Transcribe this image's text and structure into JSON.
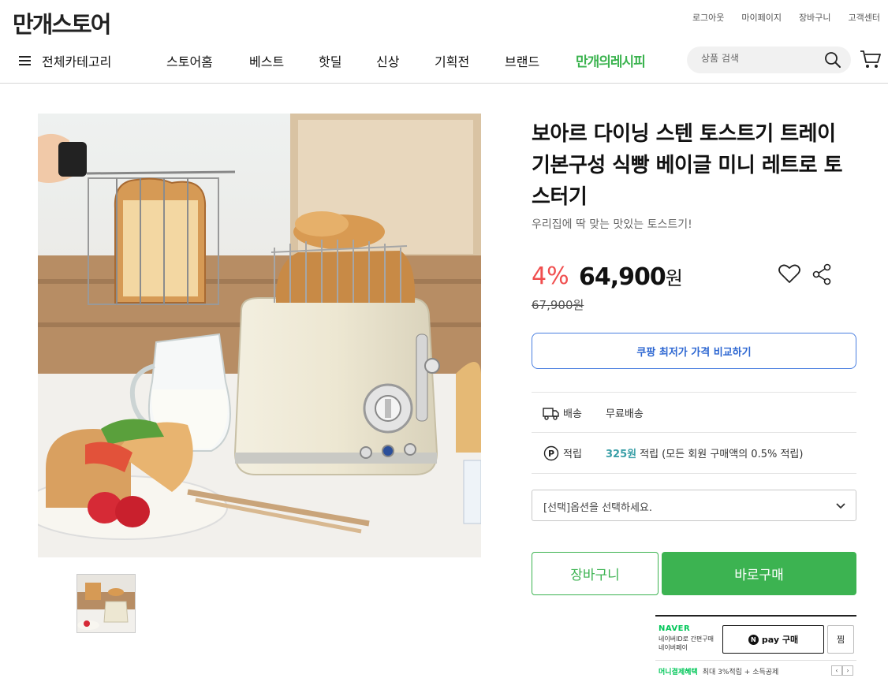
{
  "store": {
    "logo_text": "만개스토어"
  },
  "util_links": [
    "로그아웃",
    "마이페이지",
    "장바구니",
    "고객센터"
  ],
  "gnb": {
    "all_categories_label": "전체카테고리",
    "items": [
      "스토어홈",
      "베스트",
      "핫딜",
      "신상",
      "기획전",
      "브랜드"
    ],
    "special_label": "만개의레시피",
    "search_placeholder": "상품 검색"
  },
  "product": {
    "title": "보아르 다이닝 스텐 토스트기 트레이 기본구성 식빵 베이글 미니 레트로 토스터기",
    "subtitle": "우리집에 딱 맞는 맛있는 토스트기!",
    "discount": "4%",
    "price": "64,900",
    "price_unit": "원",
    "original_price": "67,900원",
    "compare_label": "쿠팡 최저가 가격 비교하기",
    "shipping": {
      "label": "배송",
      "value": "무료배송"
    },
    "points": {
      "label": "적립",
      "amount": "325원",
      "text": "적립 (모든 회원 구매액의 0.5% 적립)"
    },
    "option_placeholder": "[선택]옵션을 선택하세요.",
    "cart_label": "장바구니",
    "buy_label": "바로구매"
  },
  "naver_pay": {
    "brand": "NAVER",
    "desc_line1": "네이버ID로 간편구매",
    "desc_line2": "네이버페이",
    "pay_label": "pay 구매",
    "zzim_label": "찜",
    "promo_title": "머니결제혜택",
    "promo_text": "최대 3%적립 + 소득공제"
  },
  "colors": {
    "accent_green": "#3cb351",
    "discount_red": "#f04e4e",
    "link_blue": "#2d67d2",
    "points_teal": "#3a9fa7"
  }
}
